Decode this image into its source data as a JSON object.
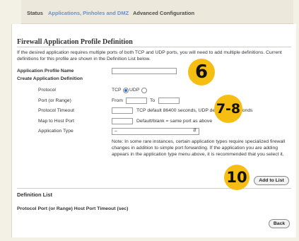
{
  "nav": {
    "tabs": [
      {
        "label": "Status"
      },
      {
        "label": "Applications, Pinholes and DMZ"
      },
      {
        "label": "Advanced Configuration"
      }
    ]
  },
  "page": {
    "title": "Firewall Application Profile Definition",
    "intro": "If the desired application requires multiple ports of both TCP and UDP ports, you will need to add multiple definitions. Current definitions for this profile are shown in the Definition List below.",
    "profile_name_label": "Application Profile Name",
    "create_label": "Create Application Definition"
  },
  "form": {
    "protocol_label": "Protocol",
    "tcp_label": "TCP",
    "udp_label": "UDP",
    "port_label": "Port (or Range)",
    "from_label": "From",
    "to_label": "To",
    "timeout_label": "Protocol Timeout",
    "timeout_hint": "TCP default 86400 seconds, UDP default 600 seconds",
    "map_label": "Map to Host Port",
    "map_hint": "Default/blank = same port as above",
    "apptype_label": "Application Type",
    "apptype_value": "–",
    "note": "Note: In some rare instances, certain application types require specialized firewall changes in addition to simple port forwarding. If the application you are adding appears in the application type menu above, it is recommended that you select it."
  },
  "buttons": {
    "add": "Add to List",
    "back": "Back"
  },
  "deflist": {
    "title": "Definition List",
    "columns": "Protocol Port (or Range) Host Port Timeout (sec)"
  },
  "callouts": [
    "6",
    "7-8",
    "10"
  ],
  "colors": {
    "callout": "#f6be12",
    "active_tab": "#6b8fc4"
  }
}
